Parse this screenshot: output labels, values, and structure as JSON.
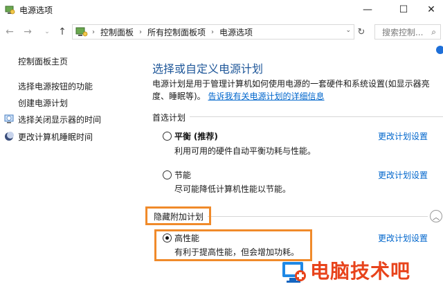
{
  "window": {
    "title": "电源选项",
    "min_glyph": "—",
    "max_glyph": "☐",
    "close_glyph": "✕"
  },
  "nav": {
    "back_glyph": "←",
    "forward_glyph": "→",
    "history_glyph": "⌄",
    "up_glyph": "↑",
    "breadcrumbs": [
      "控制面板",
      "所有控制面板项",
      "电源选项"
    ],
    "separator": "›",
    "dropdown_glyph": "⌄",
    "refresh_glyph": "↻",
    "search_placeholder": "搜索控制...",
    "search_glyph": "⌕"
  },
  "sidebar": {
    "items": [
      {
        "label": "控制面板主页"
      },
      {
        "label": "选择电源按钮的功能"
      },
      {
        "label": "创建电源计划"
      },
      {
        "label": "选择关闭显示器的时间",
        "icon": "monitor-clock-icon"
      },
      {
        "label": "更改计算机睡眠时间",
        "icon": "moon-icon"
      }
    ]
  },
  "main": {
    "title": "选择或自定义电源计划",
    "description": "电源计划是用于管理计算机如何使用电源的一套硬件和系统设置(如显示器亮度、睡眠等)。",
    "description_link": "告诉我有关电源计划的详细信息",
    "preferred_header": "首选计划",
    "hidden_header": "隐藏附加计划",
    "change_label": "更改计划设置",
    "plans": [
      {
        "name": "平衡",
        "suffix": "(推荐)",
        "desc": "利用可用的硬件自动平衡功耗与性能。",
        "selected": false
      },
      {
        "name": "节能",
        "desc": "尽可能降低计算机性能以节能。",
        "selected": false
      },
      {
        "name": "高性能",
        "desc": "有利于提高性能，但会增加功耗。",
        "selected": true
      }
    ],
    "collapse_glyph": "︿"
  },
  "watermark": {
    "text": "电脑技术吧",
    "color": "#e8431b"
  },
  "colors": {
    "accent": "#1f5799",
    "link": "#0066cc",
    "highlight": "#f08a2a"
  }
}
